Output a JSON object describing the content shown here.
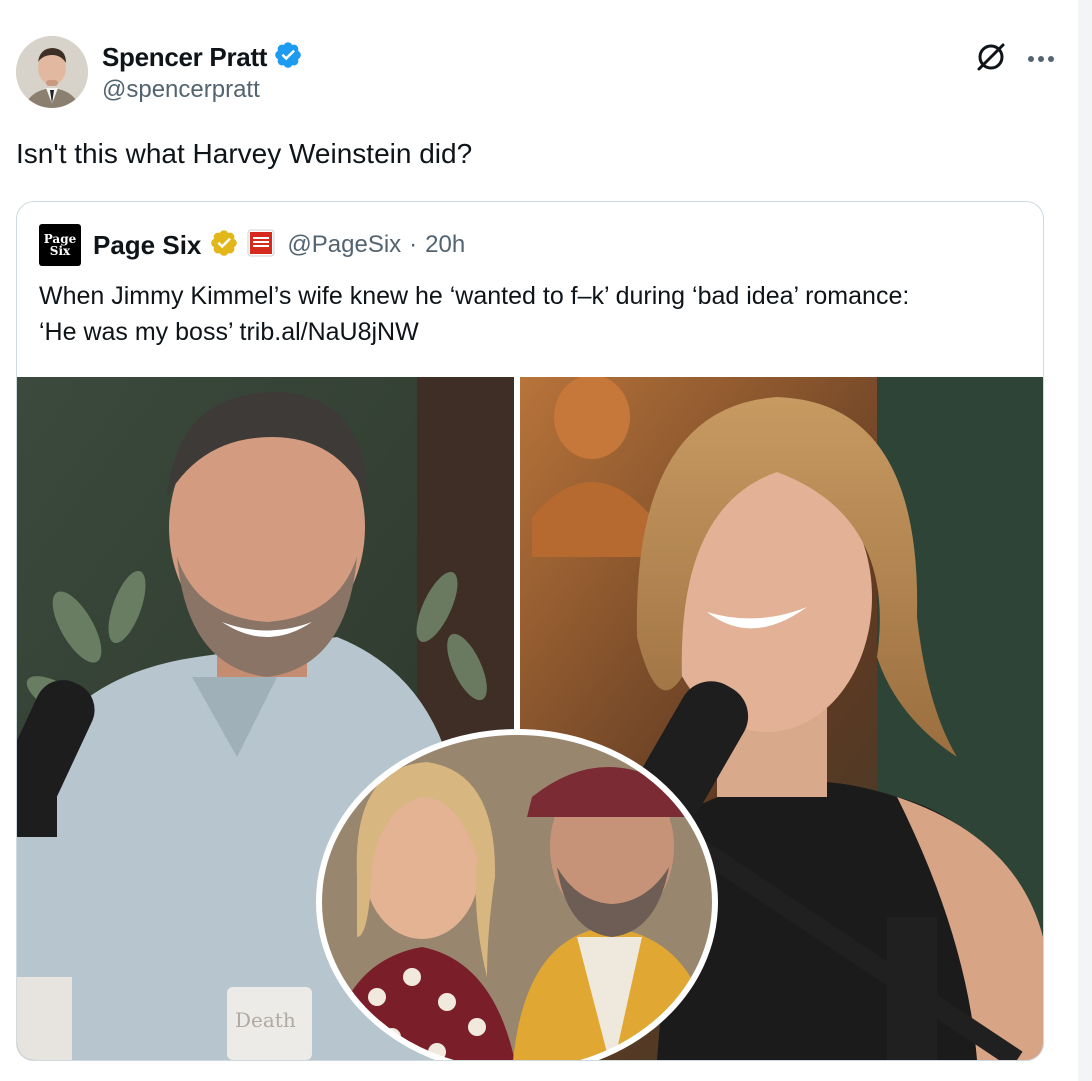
{
  "tweet": {
    "author": {
      "display_name": "Spencer Pratt",
      "handle": "@spencerpratt",
      "verified": true,
      "verified_color": "#1d9bf0"
    },
    "text": "Isn't this what Harvey Weinstein did?",
    "header_icons": [
      "grok-icon",
      "more-options-icon"
    ]
  },
  "quote": {
    "author": {
      "display_name": "Page Six",
      "logo_text": [
        "Page",
        "Six"
      ],
      "verified_type": "gold",
      "verified_color": "#e2b719",
      "affiliate_badge": "NEW YORK POST"
    },
    "meta": {
      "handle": "@PageSix",
      "separator": "·",
      "time": "20h"
    },
    "text_line1": "When Jimmy Kimmel’s wife knew he ‘wanted to f–k’ during ‘bad idea’ romance:",
    "text_line2": "‘He was my boss’ trib.al/NaU8jNW",
    "media": {
      "type": "photo-collage",
      "can_label": "Death"
    }
  }
}
